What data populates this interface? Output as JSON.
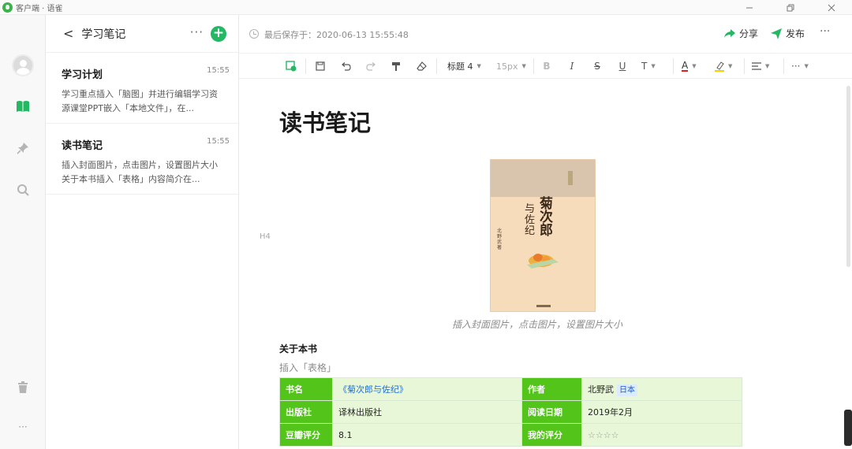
{
  "window": {
    "title": "客户端 · 语雀",
    "icons": [
      "minimize-icon",
      "restore-icon",
      "close-icon"
    ],
    "accent_color": "#25b864"
  },
  "sidebar": {
    "icons": [
      "avatar",
      "book-icon",
      "pin-icon",
      "search-icon",
      "trash-icon",
      "more-icon"
    ]
  },
  "notelist": {
    "back_glyph": "<",
    "title": "学习笔记",
    "more_glyph": "···",
    "add_glyph": "+",
    "items": [
      {
        "title": "学习计划",
        "time": "15:55",
        "desc": "学习重点插入「脑图」并进行编辑学习资源课堂PPT嵌入「本地文件」，在..."
      },
      {
        "title": "读书笔记",
        "time": "15:55",
        "desc": "插入封面图片，点击图片，设置图片大小关于本书插入「表格」内容简介在..."
      }
    ]
  },
  "editor": {
    "saved": "最后保存于：2020-06-13 15:55:48",
    "share": "分享",
    "publish": "发布",
    "more_glyph": "···",
    "toolbar": {
      "heading": "标题 4",
      "fontsize": "15px",
      "icons": [
        "insert-card-icon",
        "save-icon",
        "undo-icon",
        "redo-icon",
        "format-painter-icon",
        "eraser-icon",
        "bold-icon",
        "italic-icon",
        "strikethrough-icon",
        "underline-icon",
        "superscript-icon",
        "font-color-icon",
        "highlight-icon",
        "align-icon",
        "more-icon"
      ],
      "bold_glyph": "B",
      "italic_glyph": "I",
      "strike_glyph": "S",
      "underline_glyph": "U",
      "super_glyph": "T",
      "fontcolor_glyph": "A",
      "more_glyph": "···"
    },
    "doc": {
      "title": "读书笔记",
      "h4": "H4",
      "caption": "插入封面图片，点击图片，设置图片大小",
      "about": "关于本书",
      "table_note": "插入「表格」",
      "cover": {
        "title_line1": "菊次郎",
        "title_line2": "与佐纪",
        "author": "北野武 著"
      },
      "table": [
        [
          {
            "k": "书名",
            "v": "《菊次郎与佐纪》"
          },
          {
            "k": "作者",
            "v": "北野武",
            "tag": "日本"
          }
        ],
        [
          {
            "k": "出版社",
            "v": "译林出版社"
          },
          {
            "k": "阅读日期",
            "v": "2019年2月"
          }
        ],
        [
          {
            "k": "豆瓣评分",
            "v": "8.1"
          },
          {
            "k": "我的评分",
            "v": "☆☆☆☆"
          }
        ]
      ]
    }
  }
}
